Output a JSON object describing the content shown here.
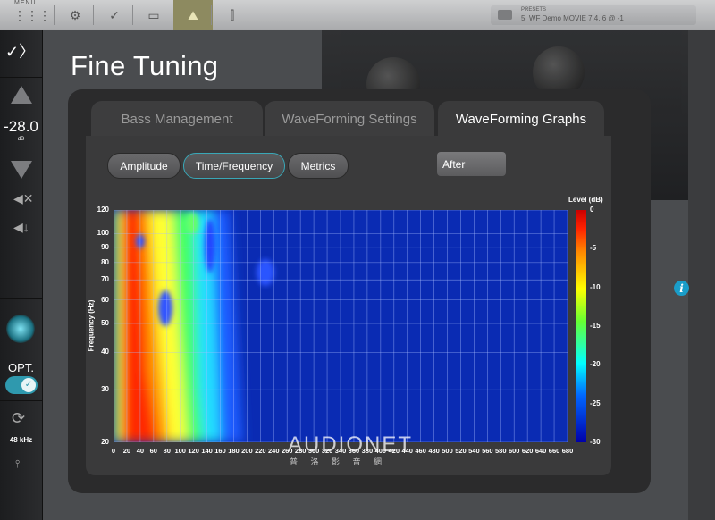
{
  "topbar": {
    "menu_label": "MENU",
    "buttons": [
      {
        "name": "menu",
        "icon": "grid-icon",
        "glyph": "⋮⋮⋮"
      },
      {
        "name": "settings",
        "icon": "gear-icon",
        "glyph": "⚙"
      },
      {
        "name": "calibration",
        "icon": "checkmark-icon",
        "glyph": "✓"
      },
      {
        "name": "display",
        "icon": "display-icon",
        "glyph": "▭"
      },
      {
        "name": "fine-tuning",
        "icon": "waveform-icon",
        "glyph": "⛰"
      },
      {
        "name": "tools",
        "icon": "cable-icon",
        "glyph": "⫿"
      }
    ],
    "preset_small": "PRESETS",
    "preset_name": "5. WF Demo MOVIE 7.4..6 @ -1"
  },
  "sidebar": {
    "logo": "✓〉",
    "volume_value": "-28.0",
    "volume_unit": "dB",
    "input_label": "OPT.",
    "sample_rate": "48 kHz"
  },
  "title": "Fine Tuning",
  "tabs": [
    {
      "label": "Bass Management",
      "active": false
    },
    {
      "label": "WaveForming Settings",
      "active": false
    },
    {
      "label": "WaveForming Graphs",
      "active": true
    }
  ],
  "view_buttons": [
    {
      "label": "Amplitude",
      "active": false
    },
    {
      "label": "Time/Frequency",
      "active": true
    },
    {
      "label": "Metrics",
      "active": false
    }
  ],
  "select": {
    "value": "After"
  },
  "watermark": {
    "main": "AUDIONET",
    "sub": "普 洛 影 音 網"
  },
  "chart_data": {
    "type": "heatmap",
    "ylabel": "Frequency (Hz)",
    "colorbar_label": "Level (dB)",
    "y_scale": "log",
    "y_ticks": [
      120,
      100,
      90,
      80,
      70,
      60,
      50,
      40,
      30,
      20
    ],
    "x_ticks": [
      0,
      20,
      40,
      60,
      80,
      100,
      120,
      140,
      160,
      180,
      200,
      220,
      240,
      260,
      280,
      300,
      320,
      340,
      360,
      380,
      400,
      420,
      440,
      460,
      480,
      500,
      520,
      540,
      560,
      580,
      600,
      620,
      640,
      660,
      680
    ],
    "colorbar_ticks": [
      0,
      -5,
      -10,
      -15,
      -20,
      -25,
      -30
    ],
    "xlim": [
      0,
      680
    ],
    "ylim": [
      20,
      120
    ],
    "clim": [
      -30,
      0
    ]
  }
}
